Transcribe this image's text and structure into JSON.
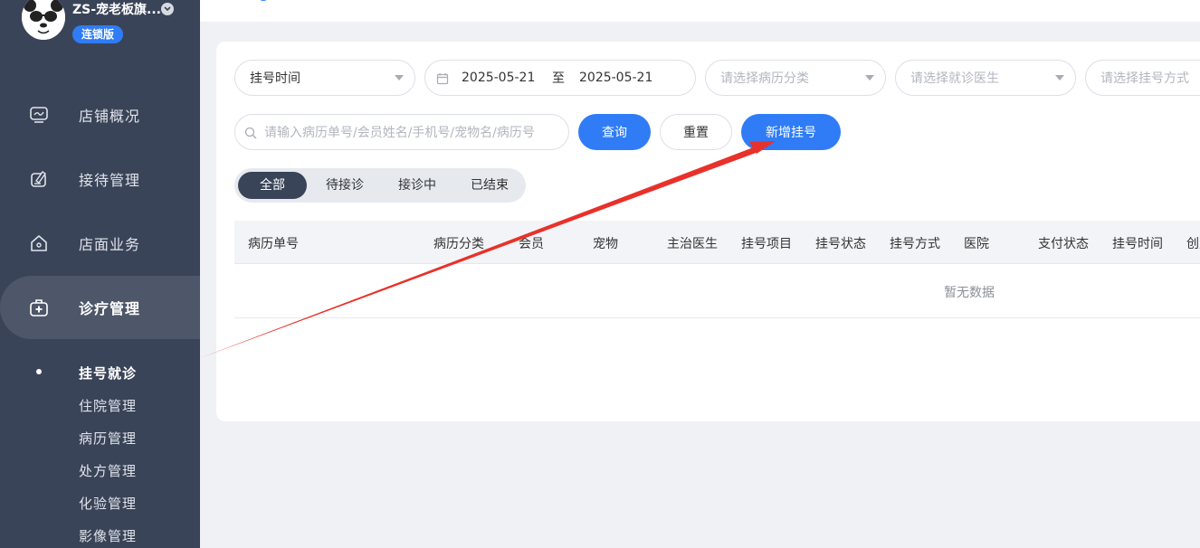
{
  "sidebar": {
    "shop_name": "ZS-宠老板旗...",
    "badge": "连锁版",
    "nav": [
      {
        "label": "店铺概况",
        "icon": "monitor-icon"
      },
      {
        "label": "接待管理",
        "icon": "edit-icon"
      },
      {
        "label": "店面业务",
        "icon": "home-icon"
      },
      {
        "label": "诊疗管理",
        "icon": "medical-kit-icon"
      }
    ],
    "sub": [
      "挂号就诊",
      "住院管理",
      "病历管理",
      "处方管理",
      "化验管理",
      "影像管理"
    ]
  },
  "filters": {
    "time_type": "挂号时间",
    "date_start": "2025-05-21",
    "date_sep": "至",
    "date_end": "2025-05-21",
    "category_placeholder": "请选择病历分类",
    "doctor_placeholder": "请选择就诊医生",
    "method_placeholder": "请选择挂号方式",
    "search_placeholder": "请输入病历单号/会员姓名/手机号/宠物名/病历号",
    "query_label": "查询",
    "reset_label": "重置",
    "add_label": "新增挂号"
  },
  "tabs": [
    "全部",
    "待接诊",
    "接诊中",
    "已结束"
  ],
  "table": {
    "columns": [
      "病历单号",
      "病历分类",
      "会员",
      "宠物",
      "主治医生",
      "挂号项目",
      "挂号状态",
      "挂号方式",
      "医院",
      "支付状态",
      "挂号时间",
      "创建"
    ],
    "empty_text": "暂无数据"
  }
}
